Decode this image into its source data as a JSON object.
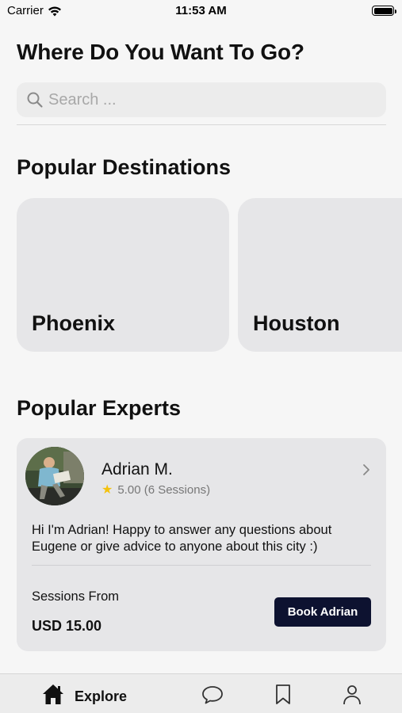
{
  "status_bar": {
    "carrier": "Carrier",
    "time": "11:53 AM"
  },
  "header": {
    "title": "Where Do You Want To Go?"
  },
  "search": {
    "placeholder": "Search ..."
  },
  "destinations": {
    "title": "Popular Destinations",
    "items": [
      {
        "name": "Phoenix"
      },
      {
        "name": "Houston"
      }
    ]
  },
  "experts": {
    "title": "Popular Experts",
    "items": [
      {
        "name": "Adrian M.",
        "rating": "5.00 (6 Sessions)",
        "bio": "Hi I'm Adrian! Happy to answer any questions about Eugene or give advice to anyone about this city :)",
        "sessions_label": "Sessions From",
        "price": "USD 15.00",
        "book_label": "Book Adrian"
      }
    ]
  },
  "tab_bar": {
    "explore_label": "Explore",
    "active_tab": "Explore",
    "icons": [
      "home-icon",
      "chat-bubble-icon",
      "bookmark-icon",
      "person-icon"
    ]
  },
  "colors": {
    "accent": "#0d1230",
    "star": "#f4c20d",
    "card_bg": "#e6e6e8",
    "page_bg": "#f6f6f6"
  }
}
